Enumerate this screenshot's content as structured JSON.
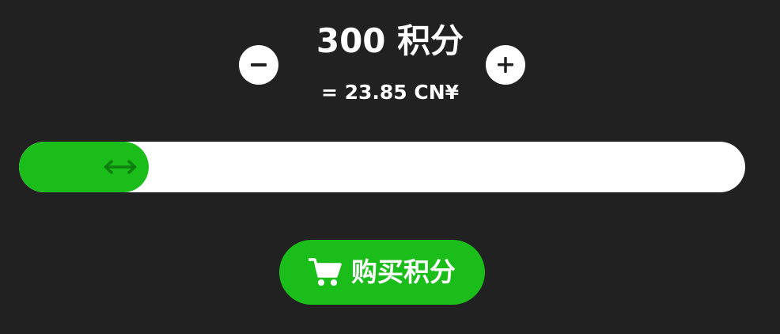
{
  "header": {
    "amount": "300 积分",
    "price": "= 23.85 CN¥"
  },
  "controls": {
    "decrease_icon": "minus-icon",
    "increase_icon": "plus-icon"
  },
  "slider": {
    "fill_fraction": 0.179,
    "handle_icon": "left-right-arrow-icon"
  },
  "buy_button": {
    "label": "购买积分",
    "icon": "shopping-cart-icon"
  },
  "colors": {
    "background": "#212121",
    "accent": "#1bbd1b",
    "handle_arrow": "#0e800e",
    "track": "#ffffff"
  }
}
